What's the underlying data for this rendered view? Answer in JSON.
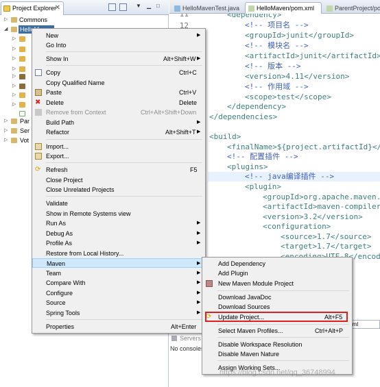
{
  "project_explorer": {
    "tab_title": "Project Explorer",
    "tree": [
      {
        "label": "Commons"
      },
      {
        "label": "HelloMaven"
      },
      {
        "label": "Par"
      },
      {
        "label": "Ser"
      },
      {
        "label": "Vot"
      }
    ]
  },
  "editor": {
    "tabs": [
      "HelloMavenTest.java",
      "HelloMaven/pom.xml",
      "ParentProject/po"
    ],
    "line_numbers": [
      "11",
      "12"
    ],
    "code_lines": [
      {
        "text": "<dependency>",
        "kind": "tag"
      },
      {
        "text": "<!-- 项目名 -->",
        "kind": "cmt"
      },
      {
        "text": "<groupId>junit</groupId>",
        "kind": "tag"
      },
      {
        "text": "<!-- 模块名 -->",
        "kind": "cmt"
      },
      {
        "text": "<artifactId>junit</artifactId>",
        "kind": "tag"
      },
      {
        "text": "<!-- 版本 -->",
        "kind": "cmt"
      },
      {
        "text": "<version>4.11</version>",
        "kind": "tag"
      },
      {
        "text": "<!-- 作用域 -->",
        "kind": "cmt"
      },
      {
        "text": "<scope>test</scope>",
        "kind": "tag"
      },
      {
        "text": "</dependency>",
        "kind": "tag"
      },
      {
        "text": "</dependencies>",
        "kind": "tag"
      },
      {
        "text": "",
        "kind": "txt"
      },
      {
        "text": "<build>",
        "kind": "tag"
      },
      {
        "text": "<finalName>${project.artifactId}</",
        "kind": "tag"
      },
      {
        "text": "<!-- 配置插件 -->",
        "kind": "cmt"
      },
      {
        "text": "<plugins>",
        "kind": "tag"
      },
      {
        "text": "<!-- java编译插件 -->",
        "kind": "cmt"
      },
      {
        "text": "<plugin>",
        "kind": "tag"
      },
      {
        "text": "<groupId>org.apache.maven.",
        "kind": "tag"
      },
      {
        "text": "<artifactId>maven-compiler",
        "kind": "tag"
      },
      {
        "text": "<version>3.2</version>",
        "kind": "tag"
      },
      {
        "text": "<configuration>",
        "kind": "tag"
      },
      {
        "text": "<source>1.7</source>",
        "kind": "tag"
      },
      {
        "text": "<target>1.7</target>",
        "kind": "tag"
      },
      {
        "text": "<encoding>UTF-8</encod",
        "kind": "tag"
      }
    ],
    "bottom_tab": "pom.xml"
  },
  "console": {
    "servers_tab": "Servers",
    "message": "No consoles"
  },
  "context_menu": {
    "items": [
      {
        "label": "New",
        "shortcut": "",
        "submenu": true
      },
      {
        "label": "Go Into",
        "shortcut": ""
      },
      {
        "label": "Show In",
        "shortcut": "Alt+Shift+W",
        "submenu": true
      },
      {
        "label": "Copy",
        "shortcut": "Ctrl+C"
      },
      {
        "label": "Copy Qualified Name",
        "shortcut": ""
      },
      {
        "label": "Paste",
        "shortcut": "Ctrl+V"
      },
      {
        "label": "Delete",
        "shortcut": "Delete"
      },
      {
        "label": "Remove from Context",
        "shortcut": "Ctrl+Alt+Shift+Down",
        "disabled": true
      },
      {
        "label": "Build Path",
        "shortcut": "",
        "submenu": true
      },
      {
        "label": "Refactor",
        "shortcut": "Alt+Shift+T",
        "submenu": true
      },
      {
        "label": "Import...",
        "shortcut": ""
      },
      {
        "label": "Export...",
        "shortcut": ""
      },
      {
        "label": "Refresh",
        "shortcut": "F5"
      },
      {
        "label": "Close Project",
        "shortcut": ""
      },
      {
        "label": "Close Unrelated Projects",
        "shortcut": ""
      },
      {
        "label": "Validate",
        "shortcut": ""
      },
      {
        "label": "Show in Remote Systems view",
        "shortcut": ""
      },
      {
        "label": "Run As",
        "shortcut": "",
        "submenu": true
      },
      {
        "label": "Debug As",
        "shortcut": "",
        "submenu": true
      },
      {
        "label": "Profile As",
        "shortcut": "",
        "submenu": true
      },
      {
        "label": "Restore from Local History...",
        "shortcut": ""
      },
      {
        "label": "Maven",
        "shortcut": "",
        "submenu": true,
        "selected": true
      },
      {
        "label": "Team",
        "shortcut": "",
        "submenu": true
      },
      {
        "label": "Compare With",
        "shortcut": "",
        "submenu": true
      },
      {
        "label": "Configure",
        "shortcut": "",
        "submenu": true
      },
      {
        "label": "Source",
        "shortcut": "",
        "submenu": true
      },
      {
        "label": "Spring Tools",
        "shortcut": "",
        "submenu": true
      },
      {
        "label": "Properties",
        "shortcut": "Alt+Enter"
      }
    ]
  },
  "maven_submenu": {
    "items": [
      {
        "label": "Add Dependency",
        "shortcut": ""
      },
      {
        "label": "Add Plugin",
        "shortcut": ""
      },
      {
        "label": "New Maven Module Project",
        "shortcut": ""
      },
      {
        "label": "Download JavaDoc",
        "shortcut": ""
      },
      {
        "label": "Download Sources",
        "shortcut": ""
      },
      {
        "label": "Update Project...",
        "shortcut": "Alt+F5",
        "highlighted": true
      },
      {
        "label": "Select Maven Profiles...",
        "shortcut": "Ctrl+Alt+P"
      },
      {
        "label": "Disable Workspace Resolution",
        "shortcut": ""
      },
      {
        "label": "Disable Maven Nature",
        "shortcut": ""
      },
      {
        "label": "Assign Working Sets...",
        "shortcut": ""
      }
    ]
  },
  "watermark": "https://blog.csdn.net/qq_36748994",
  "colors": {
    "xml_tag": "#3f7f7f",
    "xml_comment": "#3f5fbf",
    "menu_bg": "#f0f0f0",
    "menu_selected": "#cde8ff",
    "highlight_box": "#e02020",
    "tree_selected": "#3a6ea5"
  }
}
